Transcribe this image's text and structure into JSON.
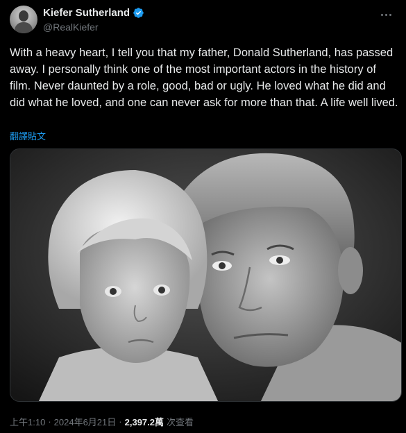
{
  "author": {
    "display_name": "Kiefer Sutherland",
    "handle": "@RealKiefer",
    "verified_icon": "verified-badge-icon",
    "avatar_icon": "avatar-photo"
  },
  "tweet": {
    "text": "With a heavy heart, I tell you that my father, Donald Sutherland, has passed away. I personally think one of the most important actors in the history of film. Never daunted by a role, good, bad or ugly. He loved what he did and did what he loved, and one can never ask for more than that. A life well lived.",
    "translate_label": "翻譯貼文",
    "image_description_icon": "black-and-white-photo"
  },
  "meta": {
    "time": "上午1:10",
    "separator": "·",
    "date": "2024年6月21日",
    "views_count": "2,397.2萬",
    "views_label": "次查看"
  },
  "colors": {
    "background": "#000000",
    "text": "#e7e9ea",
    "secondary": "#71767b",
    "accent": "#1d9bf0"
  }
}
